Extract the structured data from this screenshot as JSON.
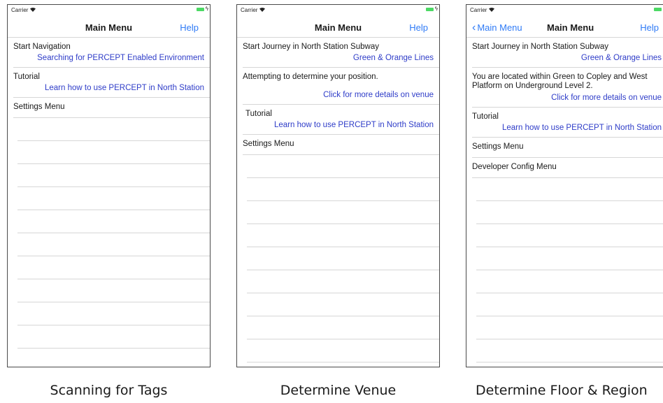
{
  "status": {
    "carrier": "Carrier"
  },
  "nav": {
    "title": "Main Menu",
    "help": "Help",
    "back": "Main Menu"
  },
  "screen1": {
    "start_navigation": "Start Navigation",
    "searching": "Searching for PERCEPT Enabled Environment",
    "tutorial": "Tutorial",
    "tutorial_sub": "Learn how to use PERCEPT in North Station",
    "settings": "Settings Menu"
  },
  "screen2": {
    "start_journey": "Start Journey in North Station Subway",
    "lines": "Green & Orange Lines",
    "attempting": "Attempting to determine your position.",
    "details": "Click for more details on venue",
    "tutorial": "Tutorial",
    "tutorial_sub": "Learn how to use PERCEPT in North Station",
    "settings": "Settings Menu"
  },
  "screen3": {
    "start_journey": "Start Journey in North Station Subway",
    "lines": "Green & Orange Lines",
    "located_line1": "You are located within Green to Copley and West",
    "located_line2": "Platform  on Underground Level 2.",
    "details": "Click for more details on venue",
    "tutorial": "Tutorial",
    "tutorial_sub": "Learn how to use PERCEPT in North Station",
    "settings": "Settings Menu",
    "developer": "Developer Config Menu"
  },
  "captions": {
    "c1": "Scanning for Tags",
    "c2": "Determine Venue",
    "c3": "Determine Floor & Region"
  },
  "colors": {
    "link": "#2e3cc8",
    "accent": "#2f7bf6",
    "battery": "#4cd964"
  }
}
